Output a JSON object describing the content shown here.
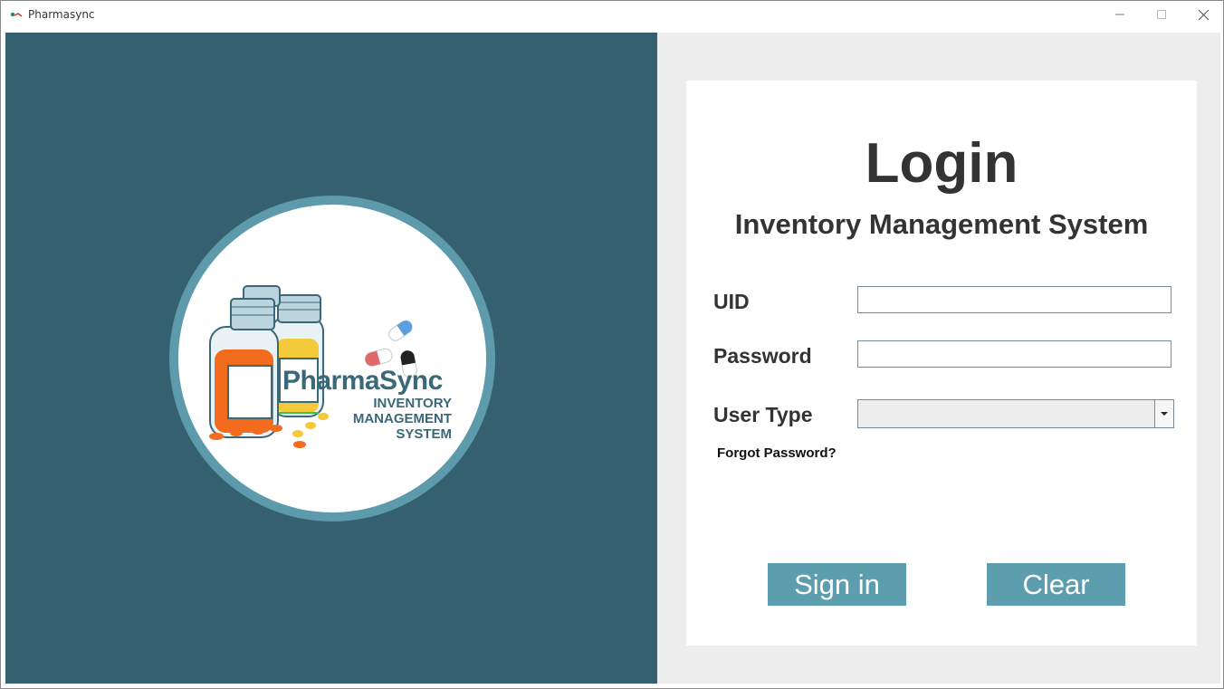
{
  "window": {
    "title": "Pharmasync",
    "icon": "app-icon",
    "controls": [
      "minimize-icon",
      "maximize-icon",
      "close-icon"
    ]
  },
  "branding": {
    "name": "PharmaSync",
    "subtitle_lines": [
      "INVENTORY",
      "MANAGEMENT",
      "SYSTEM"
    ],
    "colors": {
      "panel": "#35606f",
      "ring": "#5d9aac",
      "text": "#3a6879"
    }
  },
  "login": {
    "title": "Login",
    "subtitle": "Inventory Management System",
    "fields": {
      "uid": {
        "label": "UID",
        "value": ""
      },
      "password": {
        "label": "Password",
        "value": ""
      },
      "user_type": {
        "label": "User Type",
        "value": ""
      }
    },
    "forgot_password": "Forgot Password?",
    "buttons": {
      "sign_in": "Sign in",
      "clear": "Clear"
    },
    "colors": {
      "button": "#5d9eae",
      "text": "#333333"
    }
  }
}
